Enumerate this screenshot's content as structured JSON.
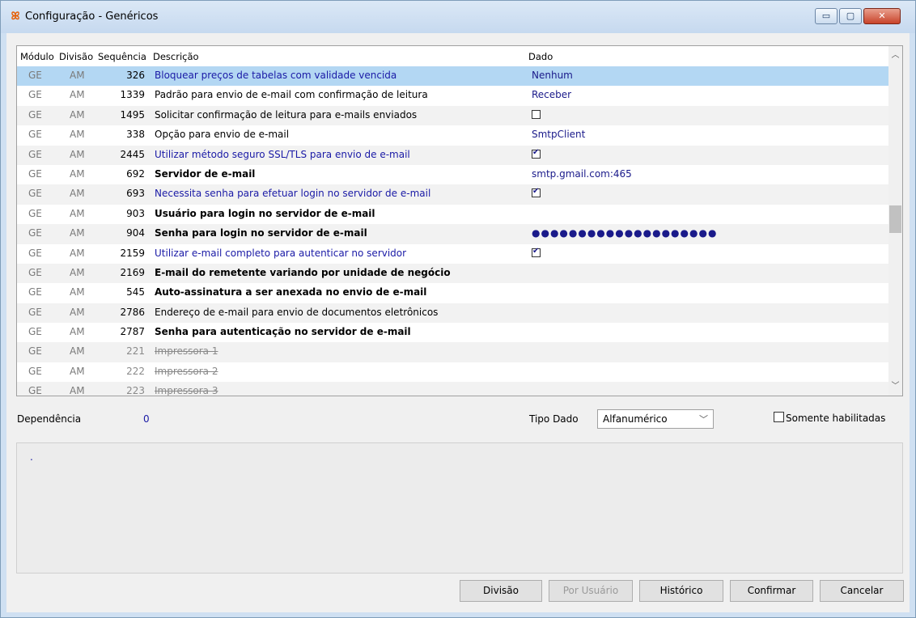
{
  "window": {
    "title": "Configuração - Genéricos",
    "minimize": "▭",
    "maximize": "▢",
    "close": "✕"
  },
  "grid": {
    "headers": {
      "modulo": "Módulo",
      "divisao": "Divisão",
      "sequencia": "Sequência",
      "descricao": "Descrição",
      "dado": "Dado"
    },
    "rows": [
      {
        "modulo": "GE",
        "divisao": "AM",
        "sequencia": "326",
        "descricao": "Bloquear preços de tabelas com validade vencida",
        "dado": "Nenhum"
      },
      {
        "modulo": "GE",
        "divisao": "AM",
        "sequencia": "1339",
        "descricao": "Padrão para envio de e-mail com confirmação de leitura",
        "dado": "Receber"
      },
      {
        "modulo": "GE",
        "divisao": "AM",
        "sequencia": "1495",
        "descricao": "Solicitar confirmação de leitura para e-mails enviados",
        "dado": ""
      },
      {
        "modulo": "GE",
        "divisao": "AM",
        "sequencia": "338",
        "descricao": "Opção para envio de e-mail",
        "dado": "SmtpClient"
      },
      {
        "modulo": "GE",
        "divisao": "AM",
        "sequencia": "2445",
        "descricao": "Utilizar método seguro SSL/TLS para envio de e-mail",
        "dado": ""
      },
      {
        "modulo": "GE",
        "divisao": "AM",
        "sequencia": "692",
        "descricao": "Servidor de e-mail",
        "dado": "smtp.gmail.com:465"
      },
      {
        "modulo": "GE",
        "divisao": "AM",
        "sequencia": "693",
        "descricao": "Necessita senha para efetuar login no servidor de e-mail",
        "dado": ""
      },
      {
        "modulo": "GE",
        "divisao": "AM",
        "sequencia": "903",
        "descricao": "Usuário para login no servidor de e-mail",
        "dado": ""
      },
      {
        "modulo": "GE",
        "divisao": "AM",
        "sequencia": "904",
        "descricao": "Senha para login no servidor de e-mail",
        "dado": "●●●●●●●●●●●●●●●●●●●●"
      },
      {
        "modulo": "GE",
        "divisao": "AM",
        "sequencia": "2159",
        "descricao": "Utilizar e-mail completo para autenticar no servidor",
        "dado": ""
      },
      {
        "modulo": "GE",
        "divisao": "AM",
        "sequencia": "2169",
        "descricao": "E-mail do remetente variando por unidade de negócio",
        "dado": ""
      },
      {
        "modulo": "GE",
        "divisao": "AM",
        "sequencia": "545",
        "descricao": "Auto-assinatura a ser anexada no envio de e-mail",
        "dado": ""
      },
      {
        "modulo": "GE",
        "divisao": "AM",
        "sequencia": "2786",
        "descricao": "Endereço de e-mail para envio de documentos eletrônicos",
        "dado": ""
      },
      {
        "modulo": "GE",
        "divisao": "AM",
        "sequencia": "2787",
        "descricao": "Senha para autenticação no servidor de e-mail",
        "dado": ""
      },
      {
        "modulo": "GE",
        "divisao": "AM",
        "sequencia": "221",
        "descricao": "Impressora 1",
        "dado": ""
      },
      {
        "modulo": "GE",
        "divisao": "AM",
        "sequencia": "222",
        "descricao": "Impressora 2",
        "dado": ""
      },
      {
        "modulo": "GE",
        "divisao": "AM",
        "sequencia": "223",
        "descricao": "Impressora 3",
        "dado": ""
      }
    ]
  },
  "footer": {
    "dependencia_label": "Dependência",
    "dependencia_value": "0",
    "tipo_dado_label": "Tipo Dado",
    "tipo_dado_value": "Alfanumérico",
    "somente_label": "Somente habilitadas",
    "memo_text": "."
  },
  "buttons": {
    "divisao": "Divisão",
    "por_usuario": "Por Usuário",
    "historico": "Histórico",
    "confirmar": "Confirmar",
    "cancelar": "Cancelar"
  }
}
